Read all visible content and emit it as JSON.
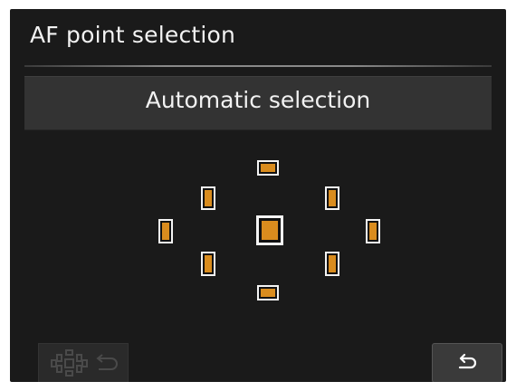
{
  "header": {
    "title": "AF point selection"
  },
  "mode": {
    "label": "Automatic selection"
  },
  "af_points": [
    {
      "id": "top",
      "icon": "af-point-horizontal",
      "selected": true
    },
    {
      "id": "upper-left",
      "icon": "af-point-vertical",
      "selected": true
    },
    {
      "id": "upper-right",
      "icon": "af-point-vertical",
      "selected": true
    },
    {
      "id": "left",
      "icon": "af-point-vertical",
      "selected": true
    },
    {
      "id": "center",
      "icon": "af-point-center",
      "selected": true
    },
    {
      "id": "right",
      "icon": "af-point-vertical",
      "selected": true
    },
    {
      "id": "lower-left",
      "icon": "af-point-vertical",
      "selected": true
    },
    {
      "id": "lower-right",
      "icon": "af-point-vertical",
      "selected": true
    },
    {
      "id": "bottom",
      "icon": "af-point-horizontal",
      "selected": true
    }
  ],
  "footer": {
    "af_direct_icon": "af-point-direct-select-icon",
    "af_direct_enabled": false,
    "back_icon": "return-arrow-icon"
  },
  "colors": {
    "selected_point": "#d98c1e",
    "point_border": "#f4f4f4",
    "background": "#1a1a1a",
    "bar": "#333333"
  }
}
